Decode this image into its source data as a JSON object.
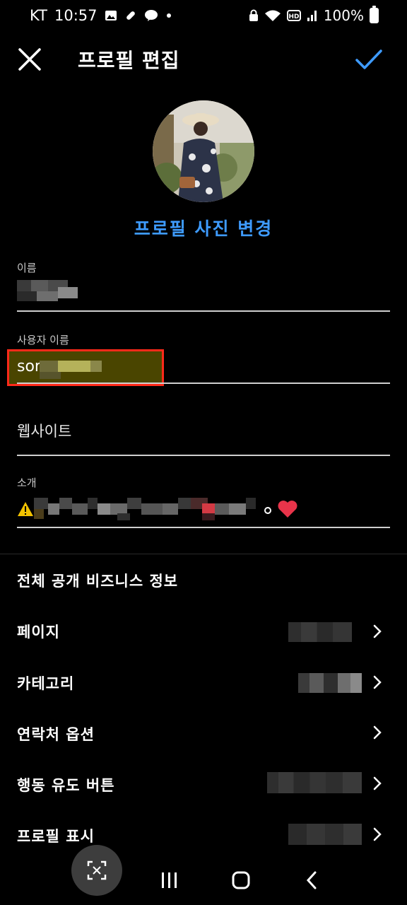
{
  "status_bar": {
    "carrier": "KT",
    "time": "10:57",
    "battery": "100%",
    "left_icons": [
      "gallery-icon",
      "pill-icon",
      "talk-icon",
      "dot-icon"
    ],
    "right_icons": [
      "lock-icon",
      "wifi-icon",
      "hd-icon",
      "signal-icon",
      "battery-icon"
    ]
  },
  "header": {
    "title": "프로필 편집",
    "close_icon": "close-icon",
    "confirm_icon": "check-icon",
    "accent": "#3e9bff"
  },
  "profile": {
    "change_photo_label": "프로필 사진 변경"
  },
  "fields": {
    "name_label": "이름",
    "username_label": "사용자 이름",
    "username_value": "sor",
    "website_placeholder": "웹사이트",
    "bio_label": "소개"
  },
  "business": {
    "section_title": "전체 공개 비즈니스 정보",
    "rows": [
      {
        "label": "페이지"
      },
      {
        "label": "카테고리"
      },
      {
        "label": "연락처 옵션"
      },
      {
        "label": "행동 유도 버튼"
      },
      {
        "label": "프로필 표시"
      }
    ]
  },
  "nav_bar": {
    "icons": [
      "capture-icon",
      "recents-icon",
      "home-icon",
      "back-icon"
    ]
  },
  "colors": {
    "background": "#000000",
    "accent": "#3e9bff",
    "highlight_border": "#ff2a1a"
  }
}
